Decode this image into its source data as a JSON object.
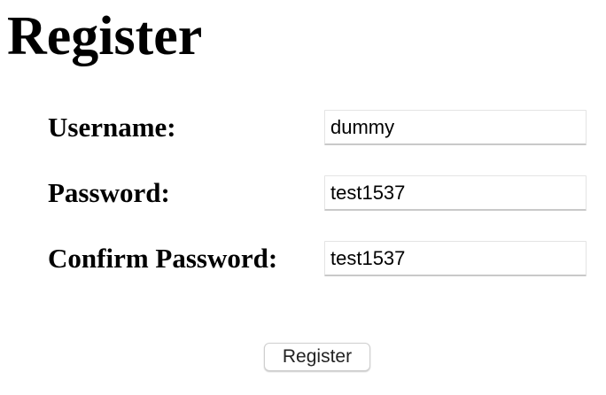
{
  "page": {
    "title": "Register"
  },
  "form": {
    "username": {
      "label": "Username:",
      "value": "dummy"
    },
    "password": {
      "label": "Password:",
      "value": "test1537"
    },
    "confirm_password": {
      "label": "Confirm Password:",
      "value": "test1537"
    },
    "submit_label": "Register"
  }
}
